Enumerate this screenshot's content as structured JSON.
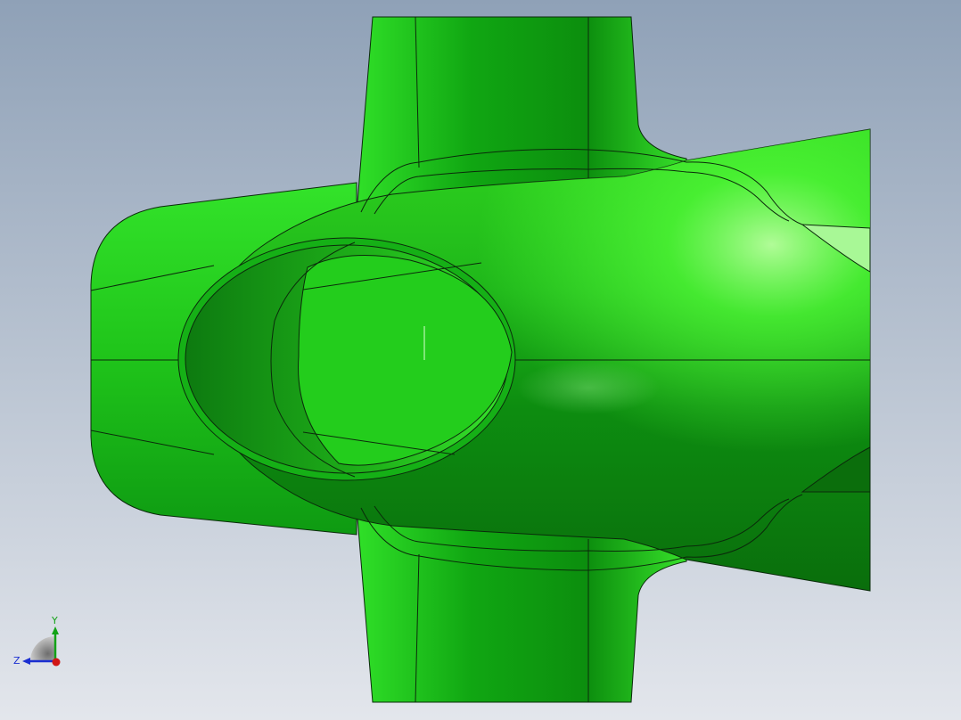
{
  "scene": {
    "background_top": "#8fa1b7",
    "background_bottom": "#e3e6ec",
    "part_color_light": "#55ff3a",
    "part_color_mid": "#1fc41a",
    "part_color_dark": "#0a6e0c",
    "edge_color": "#0b2a0b"
  },
  "triad": {
    "y_label": "Y",
    "z_label": "Z",
    "y_color": "#12a316",
    "z_color": "#1b2fd1",
    "x_color": "#d11616"
  }
}
